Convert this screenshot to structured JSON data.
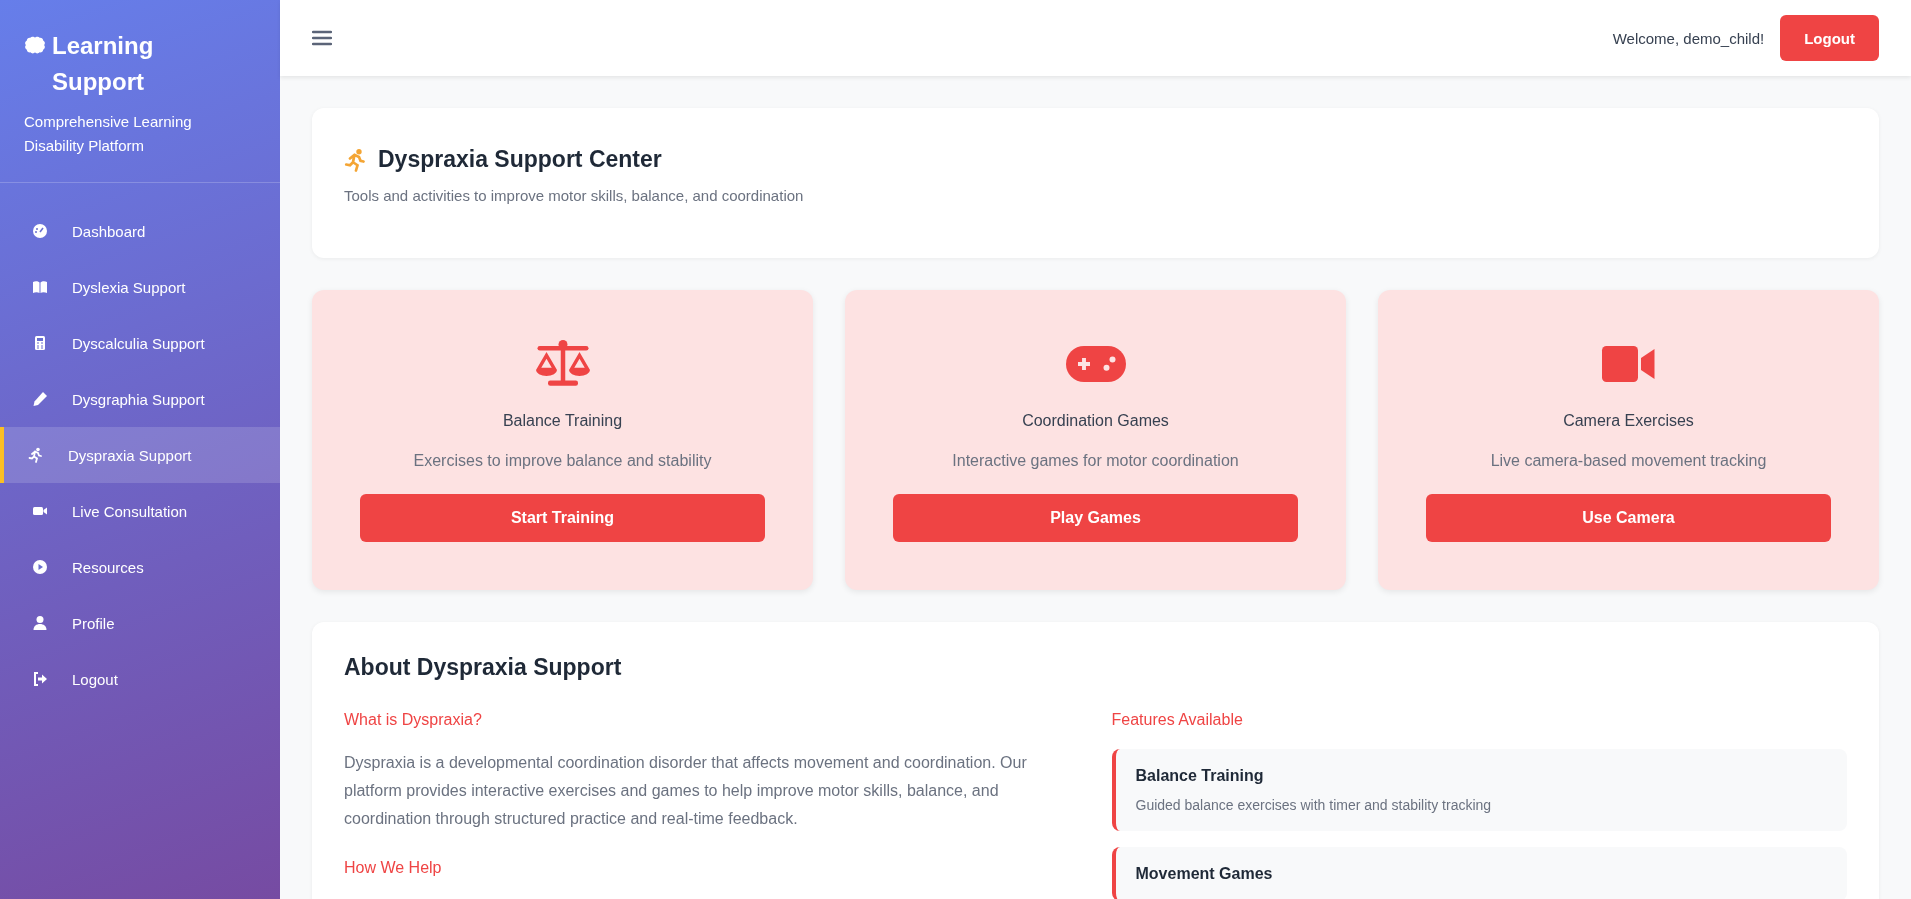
{
  "sidebar": {
    "title": "Learning Support",
    "subtitle": "Comprehensive Learning Disability Platform",
    "items": [
      {
        "label": "Dashboard",
        "selected": false
      },
      {
        "label": "Dyslexia Support",
        "selected": false
      },
      {
        "label": "Dyscalculia Support",
        "selected": false
      },
      {
        "label": "Dysgraphia Support",
        "selected": false
      },
      {
        "label": "Dyspraxia Support",
        "selected": true
      },
      {
        "label": "Live Consultation",
        "selected": false
      },
      {
        "label": "Resources",
        "selected": false
      },
      {
        "label": "Profile",
        "selected": false
      },
      {
        "label": "Logout",
        "selected": false
      }
    ]
  },
  "header": {
    "welcome": "Welcome, demo_child!",
    "logout": "Logout"
  },
  "intro": {
    "title": "Dyspraxia Support Center",
    "subtitle": "Tools and activities to improve motor skills, balance, and coordination"
  },
  "tools": [
    {
      "title": "Balance Training",
      "description": "Exercises to improve balance and stability",
      "button": "Start Training"
    },
    {
      "title": "Coordination Games",
      "description": "Interactive games for motor coordination",
      "button": "Play Games"
    },
    {
      "title": "Camera Exercises",
      "description": "Live camera-based movement tracking",
      "button": "Use Camera"
    }
  ],
  "about": {
    "title": "About Dyspraxia Support",
    "what_heading": "What is Dyspraxia?",
    "what_text": "Dyspraxia is a developmental coordination disorder that affects movement and coordination. Our platform provides interactive exercises and games to help improve motor skills, balance, and coordination through structured practice and real-time feedback.",
    "help_heading": "How We Help",
    "features_heading": "Features Available",
    "features": [
      {
        "title": "Balance Training",
        "description": "Guided balance exercises with timer and stability tracking"
      },
      {
        "title": "Movement Games"
      }
    ]
  }
}
